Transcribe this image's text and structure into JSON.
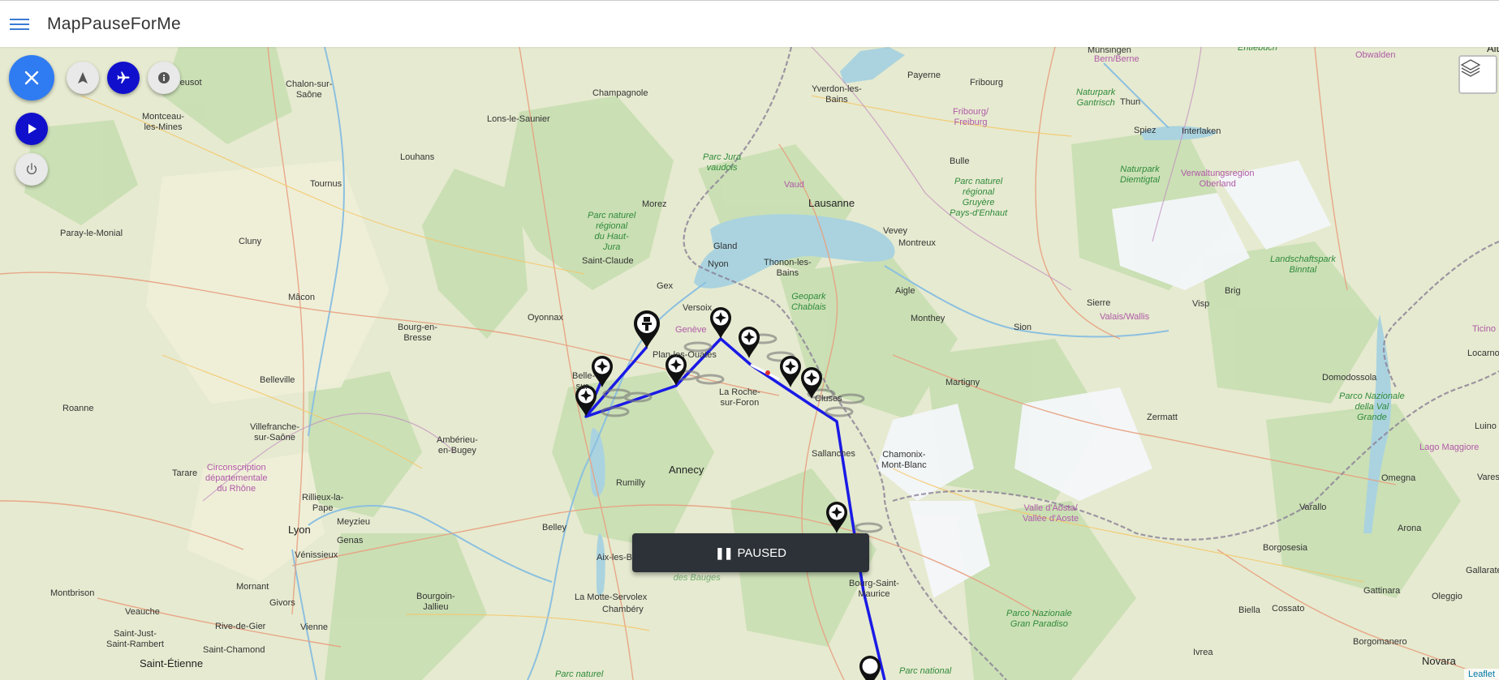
{
  "app": {
    "title": "MapPauseForMe",
    "menu_icon": "hamburger-menu-icon"
  },
  "controls": {
    "close_icon": "close-icon",
    "navigate_icon": "navigation-arrow-icon",
    "flight_icon": "airplane-icon",
    "info_icon": "info-icon",
    "play_icon": "play-icon",
    "power_icon": "power-icon",
    "layers_icon": "layers-icon"
  },
  "status": {
    "label": "PAUSED",
    "icon": "pause-icon"
  },
  "attribution": "Leaflet",
  "colors": {
    "route": "#1a1ae6",
    "fab": "#2f7bf2",
    "active_button": "#1010cc",
    "toast": "#2c3237"
  },
  "map_labels": {
    "altdorf": "Altdorf",
    "munsingen": "Münsingen",
    "entlebuch": "Entlebuch",
    "bern": "Bern/Berne",
    "obwalden": "Obwalden",
    "payerne": "Payerne",
    "fribourg": "Fribourg",
    "chalon": "Chalon-sur-\nSaône",
    "reusot": "reusot",
    "yverdon": "Yverdon-les-\nBains",
    "gantrisch": "Naturpark\nGantrisch",
    "thun": "Thun",
    "fribourg_freiburg": "Fribourg/\nFreiburg",
    "spiez": "Spiez",
    "interlaken": "Interlaken",
    "champagnole": "Champagnole",
    "montceau": "Montceau-\nles-Mines",
    "lons": "Lons-le-Saunier",
    "louhans": "Louhans",
    "parc_jura": "Parc Jura\nvaudois",
    "bulle": "Bulle",
    "parc_gruyere": "Parc naturel\nrégional\nGruyère\nPays-d'Enhaut",
    "diemtigtal": "Naturpark\nDiemtigtal",
    "oberland": "Verwaltungsregion\nOberland",
    "tournus": "Tournus",
    "vaud": "Vaud",
    "lausanne": "Lausanne",
    "morez": "Morez",
    "haut_jura": "Parc naturel\nrégional\ndu Haut-\nJura",
    "paray": "Paray-le-Monial",
    "cluny": "Cluny",
    "gland": "Gland",
    "vevey": "Vevey",
    "montreux": "Montreux",
    "saint_claude": "Saint-Claude",
    "nyon": "Nyon",
    "thonon": "Thonon-les-\nBains",
    "binntal": "Landschaftspark\nBinntal",
    "macon": "Mâcon",
    "gex": "Gex",
    "aigle": "Aigle",
    "brig": "Brig",
    "sierre": "Sierre",
    "visp": "Visp",
    "oyonnax": "Oyonnax",
    "versoix": "Versoix",
    "geopark": "Geopark\nChablais",
    "valais": "Valais/Wallis",
    "bourg": "Bourg-en-\nBresse",
    "monthey": "Monthey",
    "sion": "Sion",
    "geneve": "Genève",
    "plan": "Plan-les-Ouates",
    "ticino": "Ticino",
    "locarno": "Locarno",
    "belle": "Belle-\nsur-",
    "belleville": "Belleville",
    "martigny": "Martigny",
    "domodossola": "Domodossola",
    "roche": "La Roche-\nsur-Foron",
    "cluses": "Cluses",
    "zermatt": "Zermatt",
    "valgrande": "Parco Nazionale\ndella Val\nGrande",
    "roanne": "Roanne",
    "villefranche": "Villefranche-\nsur-Saône",
    "amberieu": "Ambérieu-\nen-Bugey",
    "chamonix": "Chamonix-\nMont-Blanc",
    "lugano": "Luino",
    "sallanches": "Sallanches",
    "maggiore": "Lago Maggiore",
    "circonscription": "Circonscription\ndépartementale\ndu Rhône",
    "tarare": "Tarare",
    "annecy": "Annecy",
    "omegna": "Omegna",
    "varese": "Varese",
    "rumilly": "Rumilly",
    "rillieux": "Rillieux-la-\nPape",
    "valle_aosta": "Valle d'Aosta/\nVallée d'Aoste",
    "varallo": "Varallo",
    "arona": "Arona",
    "lyon": "Lyon",
    "meyzieu": "Meyzieu",
    "belley": "Belley",
    "genas": "Genas",
    "venissieux": "Vénissieux",
    "borgosesia": "Borgosesia",
    "aix": "Aix-les-Bains",
    "bauges": "Parc naturel\nrégional\ndu Massif\ndes Bauges",
    "gallarate": "Gallarate",
    "bourg_st_maurice": "Bourg-Saint-\nMaurice",
    "montbrison": "Montbrison",
    "mornant": "Mornant",
    "bourgoin": "Bourgoin-\nJallieu",
    "motte": "La Motte-Servolex",
    "biella": "Biella",
    "cossato": "Cossato",
    "gattinara": "Gattinara",
    "oleggio": "Oleggio",
    "veauche": "Veauche",
    "givors": "Givors",
    "chambery": "Chambéry",
    "gran_paradiso": "Parco Nazionale\nGran Paradiso",
    "rive_de_gier": "Rive-de-Gier",
    "vienne": "Vienne",
    "saint_just": "Saint-Just-\nSaint-Rambert",
    "saint_chamond": "Saint-Chamond",
    "ivrea": "Ivrea",
    "borgomanero": "Borgomanero",
    "novara": "Novara",
    "saint_etienne": "Saint-Étienne",
    "parc_bottom": "Parc naturel",
    "parc_national": "Parc national"
  }
}
